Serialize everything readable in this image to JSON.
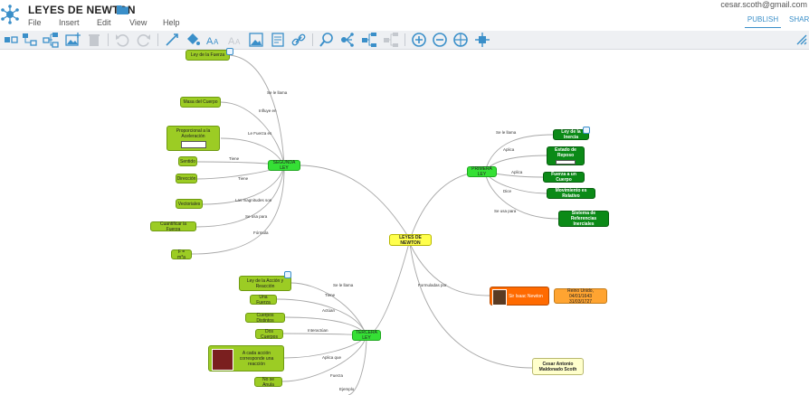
{
  "app": {
    "title": "LEYES DE NEWTON",
    "user": "cesar.scoth@gmail.com",
    "publish_label": "PUBLISH",
    "share_label": "SHARE",
    "menu": [
      {
        "label": "File"
      },
      {
        "label": "Insert"
      },
      {
        "label": "Edit"
      },
      {
        "label": "View"
      },
      {
        "label": "Help"
      }
    ],
    "accent": "#3a8fc9"
  },
  "toolbar": [
    "add-topic-icon",
    "add-subtopic-icon",
    "add-relation-icon",
    "insert-image-icon",
    "delete-icon",
    "undo-icon",
    "redo-icon",
    "connector-icon",
    "fill-color-icon",
    "font-size-icon",
    "font-style-icon",
    "image-icon",
    "note-icon",
    "link-icon",
    "find-icon",
    "layout-icon",
    "tree-icon",
    "unlink-icon",
    "zoom-in-icon",
    "zoom-out-icon",
    "zoom-fit-icon",
    "expand-icon",
    "collapse-panel-icon"
  ],
  "map": {
    "central": "LEYES DE NEWTON",
    "segunda": {
      "title": "SEGUNDA LEY",
      "children": [
        {
          "label": "Ley de la Fuerza",
          "edge": "Se le llama"
        },
        {
          "label": "Masa del Cuerpo",
          "edge": "Influye en"
        },
        {
          "label": "Proporcional a la Aceleración",
          "edge": "Le Fuerza es"
        },
        {
          "label": "Sentido",
          "edge": "Tiene"
        },
        {
          "label": "Dirección",
          "edge": "Tiene"
        },
        {
          "label": "Vectoriales",
          "edge": "Las magnitudes son"
        },
        {
          "label": "Cuantificar la Fuerza",
          "edge": "Se usa para"
        },
        {
          "label": "F = m*a",
          "edge": "Fórmula"
        }
      ]
    },
    "primera": {
      "title": "PRIMERA LEY",
      "children": [
        {
          "label": "Ley de la Inercia",
          "edge": "Se le llama"
        },
        {
          "label": "Estado de Reposo",
          "edge": "Aplica"
        },
        {
          "label": "Fuerza a un Cuerpo",
          "edge": "Aplica"
        },
        {
          "label": "Movimiento es Relativo",
          "edge": "Dice"
        },
        {
          "label": "Sistema de Referencias Inerciales",
          "edge": "Se usa para"
        }
      ]
    },
    "tercera": {
      "title": "TERCERA LEY",
      "children": [
        {
          "label": "Ley de la Acción y Reacción",
          "edge": "Se le llama"
        },
        {
          "label": "Una Fuerza",
          "edge": "Tiene"
        },
        {
          "label": "Cuerpos Distintos",
          "edge": "Actúan"
        },
        {
          "label": "Dos Cuerpos",
          "edge": "Interactúan"
        },
        {
          "label": "A cada acción corresponde una reacción",
          "edge": "Aplica que"
        },
        {
          "label": "No se Anula",
          "edge": "Fuerza"
        },
        {
          "label": "",
          "edge": "Ejemplo"
        }
      ]
    },
    "formulated": {
      "edge": "Formuladas por",
      "author": "Sir Isaac Newton",
      "birth": "Reino Unido, 04/01/1643",
      "death": "31/03/1727"
    },
    "credit": "Cesar Antonio Maldonado Scoth"
  },
  "colors": {
    "light_green": "#9ccc24",
    "bright_green": "#35e035",
    "dark_green": "#0b8a17",
    "yellow": "#ffff4d",
    "orange": "#ff6a00",
    "light_orange": "#ffa431",
    "toolbar_icon": "#3a8fc9"
  }
}
